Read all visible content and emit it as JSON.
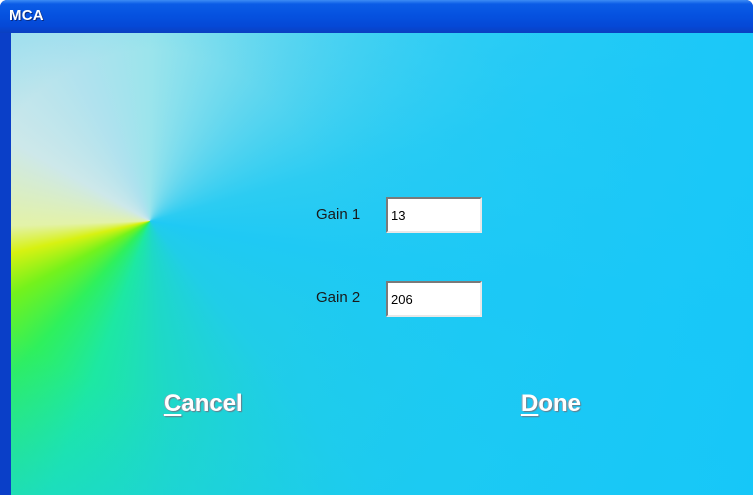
{
  "window": {
    "title": "MCA"
  },
  "form": {
    "gain1": {
      "label": "Gain 1",
      "value": "13"
    },
    "gain2": {
      "label": "Gain 2",
      "value": "206"
    }
  },
  "buttons": {
    "cancel": {
      "mnemonic": "C",
      "rest": "ancel"
    },
    "done": {
      "mnemonic": "D",
      "rest": "one"
    }
  },
  "colors": {
    "titlebar": "#0552e0",
    "background_main": "#1fc9f4",
    "background_accent_yellow": "#d7f212",
    "background_accent_green": "#2ff05c",
    "button_text": "#ffffff"
  },
  "icons": []
}
